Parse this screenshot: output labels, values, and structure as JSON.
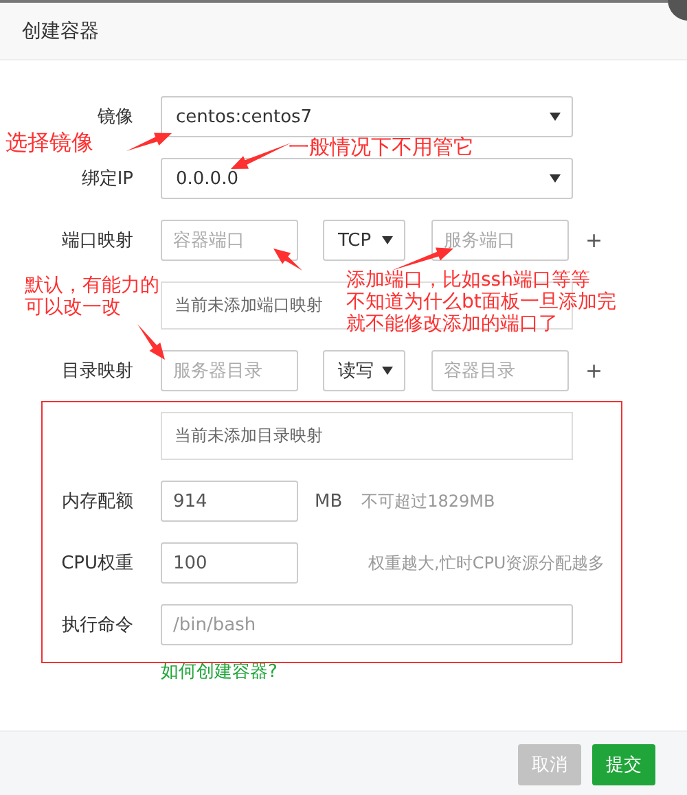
{
  "dialog": {
    "title": "创建容器"
  },
  "fields": [
    {
      "kind": "select",
      "label": "镜像",
      "value": "centos:centos7"
    },
    {
      "kind": "select",
      "label": "绑定IP",
      "value": "0.0.0.0"
    },
    {
      "kind": "mapping",
      "label": "端口映射",
      "left_placeholder": "容器端口",
      "mode": "TCP",
      "right_placeholder": "服务端口",
      "add": "+"
    },
    {
      "kind": "list",
      "empty_text": "当前未添加端口映射"
    },
    {
      "kind": "mapping",
      "label": "目录映射",
      "left_placeholder": "服务器目录",
      "mode": "读写",
      "right_placeholder": "容器目录",
      "add": "+"
    },
    {
      "kind": "list",
      "empty_text": "当前未添加目录映射"
    },
    {
      "kind": "number",
      "label": "内存配额",
      "value": "914",
      "unit": "MB",
      "hint": "不可超过1829MB"
    },
    {
      "kind": "number",
      "label": "CPU权重",
      "value": "100",
      "hint": "权重越大,忙时CPU资源分配越多"
    },
    {
      "kind": "command",
      "label": "执行命令",
      "placeholder": "/bin/bash"
    }
  ],
  "help_link": "如何创建容器?",
  "buttons": [
    {
      "label": "取消",
      "kind": "secondary"
    },
    {
      "label": "提交",
      "kind": "primary"
    }
  ],
  "annotations": [
    {
      "lines": [
        "选择镜像"
      ]
    },
    {
      "lines": [
        "一般情况下不用管它"
      ]
    },
    {
      "lines": [
        "默认，有能力的",
        "可以改一改"
      ]
    },
    {
      "lines": [
        "添加端口，比如ssh端口等等",
        "不知道为什么bt面板一旦添加完",
        "就不能修改添加的端口了"
      ]
    }
  ]
}
